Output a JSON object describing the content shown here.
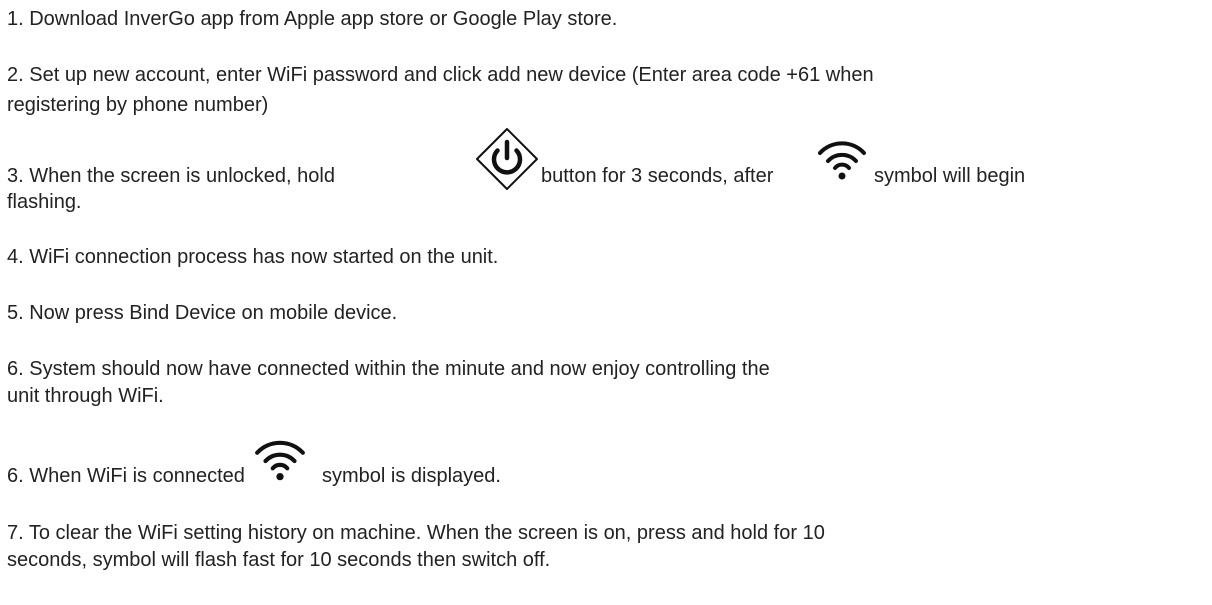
{
  "instructions": {
    "step1": "1. Download InverGo app from Apple app store or Google Play store.",
    "step2_line1": "2. Set up new account, enter WiFi password and click add new device (Enter area code +61 when",
    "step2_line2": "registering by phone number)",
    "step3_part1": "3. When the screen is unlocked, hold",
    "step3_part2": "button for 3 seconds, after",
    "step3_part3": "symbol will begin",
    "step3_line2": "flashing.",
    "step4": "4. WiFi connection process has now started on the unit.",
    "step5": "5. Now press Bind Device on mobile device.",
    "step6a_line1": "6. System should now have connected within the minute and now enjoy controlling the",
    "step6a_line2": "unit through WiFi.",
    "step6b_part1": "6. When WiFi is connected",
    "step6b_part2": "symbol is displayed.",
    "step7_line1": "7. To clear the WiFi setting history on machine. When the screen is on, press and hold for 10",
    "step7_line2": "seconds,   symbol will flash fast for 10 seconds then switch off."
  },
  "icons": {
    "power": "power-button-icon",
    "wifi": "wifi-icon"
  }
}
